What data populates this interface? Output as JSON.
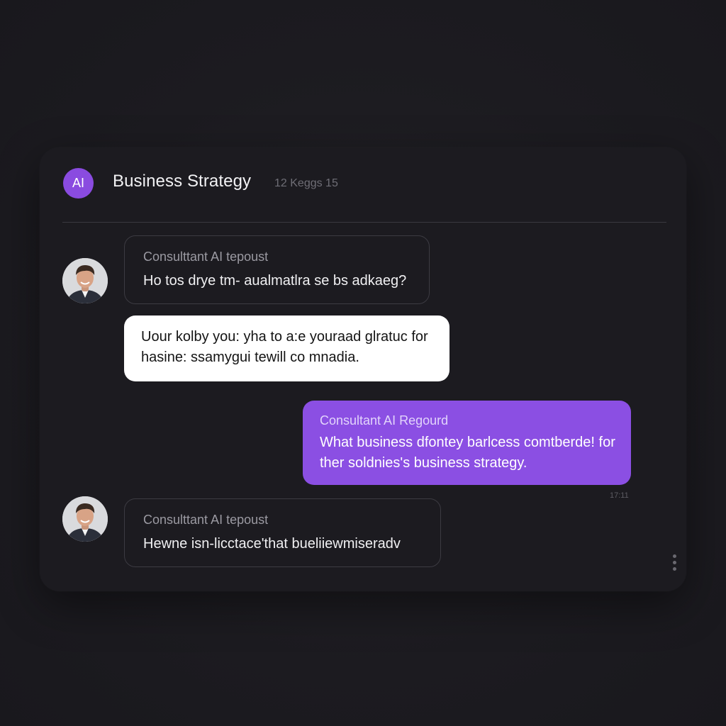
{
  "header": {
    "avatar_label": "AI",
    "title": "Business Strategy",
    "meta": "12 Keggs  15"
  },
  "messages": [
    {
      "sender": "Consulttant AI tepoust",
      "text": "Ho tos drye tm- aualmatlra se bs adkaeg?"
    },
    {
      "sender": "",
      "text": "Uour kolby you: yha to a:e youraad glratuc for hasine: ssamygui tewill co mnadia."
    },
    {
      "sender": "Consultant AI Regourd",
      "text": "What business dfontey barlcess comtberde! for ther soldnies's business strategy.",
      "time": "17:11"
    },
    {
      "sender": "Consulttant AI tepoust",
      "text": "Hewne isn-licctace'that bueliiewmiseradv"
    }
  ],
  "colors": {
    "accent_purple": "#8b4fe3",
    "background": "#1d1c21",
    "incoming_white": "#ffffff"
  },
  "icons": {
    "avatar": "person-photo",
    "menu": "vertical-dots-icon"
  }
}
